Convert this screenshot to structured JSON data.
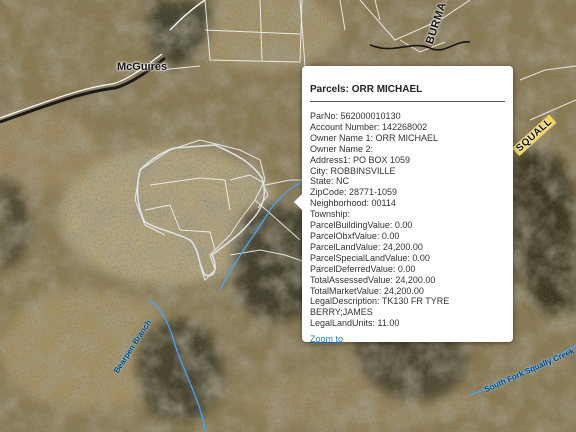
{
  "map": {
    "place_label": "McGuires",
    "road_labels": [
      "BURMA RD",
      "SQUALL"
    ],
    "stream_labels": [
      "Bearpen Branch",
      "South Fork Squally Creek"
    ]
  },
  "popup": {
    "title": "Parcels: ORR MICHAEL",
    "fields": [
      "ParNo: 562000010130",
      "Account Number: 142268002",
      "Owner Name 1: ORR MICHAEL",
      "Owner Name 2:",
      "Address1: PO BOX 1059",
      "City: ROBBINSVILLE",
      "State: NC",
      "ZipCode: 28771-1059",
      "Neighborhood: 00114",
      "Township:",
      "ParcelBuildingValue: 0.00",
      "ParcelObxfValue: 0.00",
      "ParcelLandValue: 24,200.00",
      "ParcelSpecialLandValue: 0.00",
      "ParcelDeferredValue: 0.00",
      "TotalAssessedValue: 24,200.00",
      "TotalMarketValue: 24,200.00",
      "LegalDescription: TK130 FR TYRE BERRY;JAMES",
      "LegalLandUnits: 11.00"
    ],
    "zoom_link": "Zoom to"
  }
}
